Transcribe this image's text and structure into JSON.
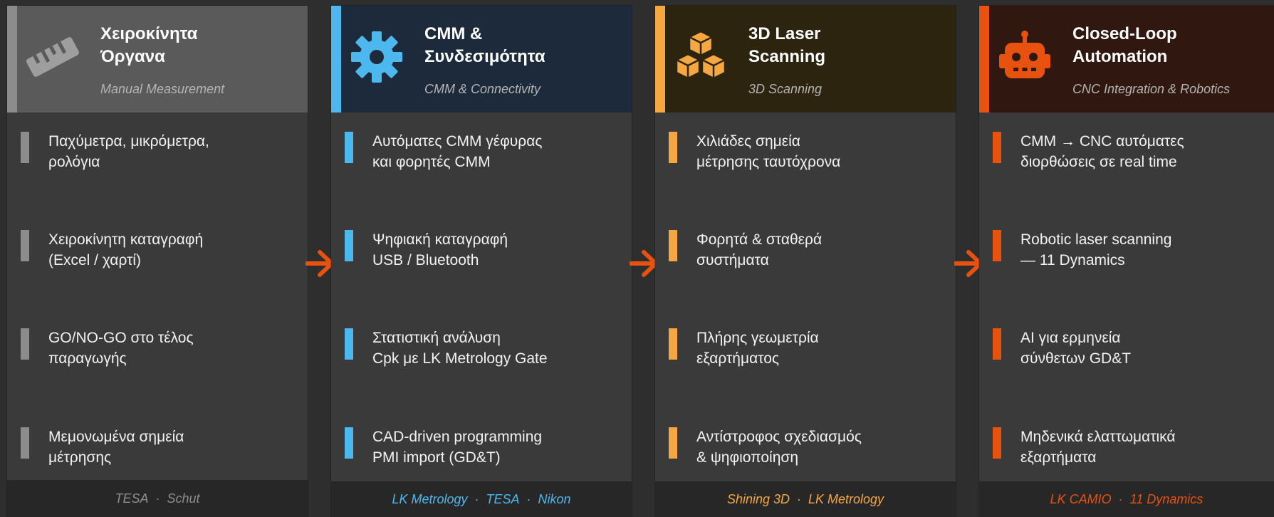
{
  "arrow_color": "#e8520f",
  "columns": [
    {
      "title": "Χειροκίνητα\nΌργανα",
      "subtitle": "Manual Measurement",
      "icon": "ruler-icon",
      "accent": "#8c8c8c",
      "header_bg": "#5a5a5a",
      "items": [
        "Παχύμετρα, μικρόμετρα,\nρολόγια",
        "Χειροκίνητη καταγραφή\n(Excel / χαρτί)",
        "GO/NO-GO στο τέλος\nπαραγωγής",
        "Μεμονωμένα σημεία\nμέτρησης"
      ],
      "vendors": [
        "TESA",
        "Schut"
      ],
      "vendor_color": "#8e8e8e"
    },
    {
      "title": "CMM &\nΣυνδεσιμότητα",
      "subtitle": "CMM & Connectivity",
      "icon": "gear-icon",
      "accent": "#4cb8ee",
      "header_bg": "#1c2a3c",
      "items": [
        "Αυτόματες CMM γέφυρας\nκαι φορητές CMM",
        "Ψηφιακή καταγραφή\nUSB / Bluetooth",
        "Στατιστική ανάλυση\nCpk με LK Metrology Gate",
        "CAD-driven programming\nPMI import (GD&T)"
      ],
      "vendors": [
        "LK Metrology",
        "TESA",
        "Nikon"
      ],
      "vendor_color": "#4cb8ee"
    },
    {
      "title": "3D Laser\nScanning",
      "subtitle": "3D Scanning",
      "icon": "cubes-icon",
      "accent": "#f5a742",
      "header_bg": "#2d2410",
      "items": [
        "Χιλιάδες σημεία\nμέτρησης ταυτόχρονα",
        "Φορητά & σταθερά\nσυστήματα",
        "Πλήρης γεωμετρία\nεξαρτήματος",
        "Αντίστροφος σχεδιασμός\n& ψηφιοποίηση"
      ],
      "vendors": [
        "Shining 3D",
        "LK Metrology"
      ],
      "vendor_color": "#f5a742"
    },
    {
      "title": "Closed-Loop\nAutomation",
      "subtitle": "CNC Integration & Robotics",
      "icon": "robot-icon",
      "accent": "#e8520f",
      "header_bg": "#301810",
      "items": [
        "CMM → CNC αυτόματες\nδιορθώσεις σε real time",
        "Robotic laser scanning\n— 11 Dynamics",
        "AI για ερμηνεία\nσύνθετων GD&T",
        "Μηδενικά ελαττωματικά\nεξαρτήματα"
      ],
      "vendors": [
        "LK CAMIO",
        "11 Dynamics"
      ],
      "vendor_color": "#e8520f"
    }
  ]
}
